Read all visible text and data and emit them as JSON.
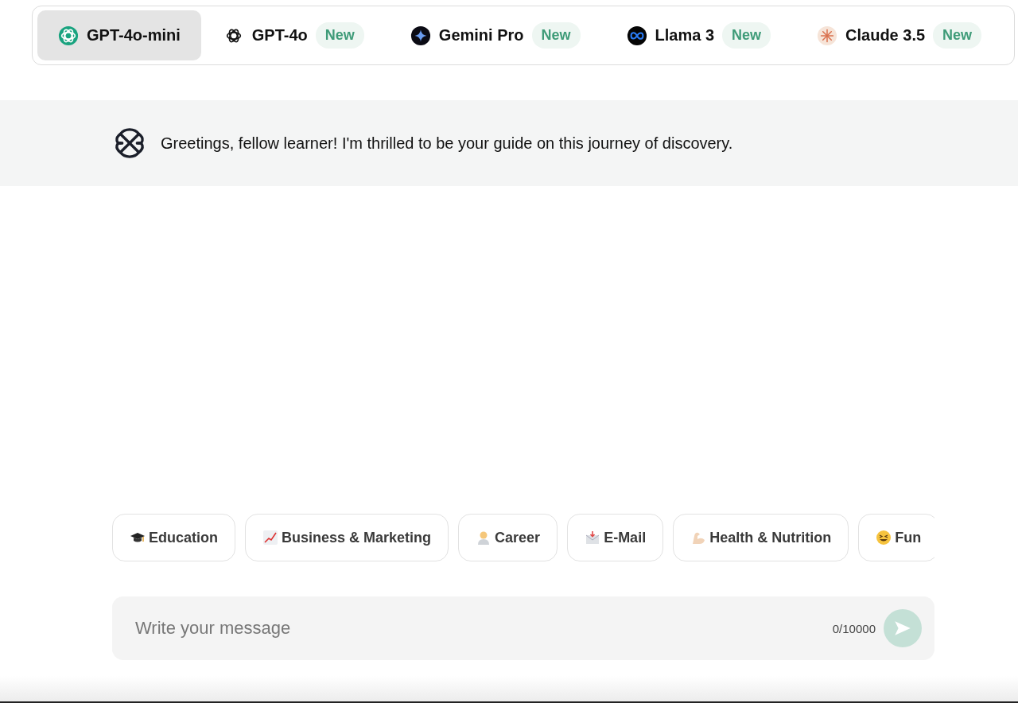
{
  "model_tabs": [
    {
      "label": "GPT-4o-mini",
      "selected": true
    },
    {
      "label": "GPT-4o",
      "badge": "New",
      "selected": false
    },
    {
      "label": "Gemini Pro",
      "badge": "New",
      "selected": false
    },
    {
      "label": "Llama 3",
      "badge": "New",
      "selected": false
    },
    {
      "label": "Claude 3.5",
      "badge": "New",
      "selected": false
    }
  ],
  "greeting": {
    "text": "Greetings, fellow learner! I'm thrilled to be your guide on this journey of discovery."
  },
  "topic_chips": [
    {
      "label": "Education"
    },
    {
      "label": "Business & Marketing"
    },
    {
      "label": "Career"
    },
    {
      "label": "E-Mail"
    },
    {
      "label": "Health & Nutrition"
    },
    {
      "label": "Fun"
    }
  ],
  "composer": {
    "placeholder": "Write your message",
    "counter": "0/10000"
  }
}
